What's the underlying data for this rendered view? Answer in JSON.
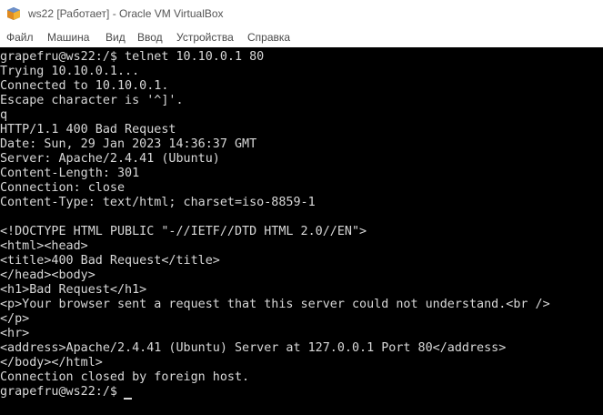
{
  "window": {
    "title": "ws22 [Работает] - Oracle VM VirtualBox"
  },
  "menu": {
    "items": [
      {
        "label": "Файл"
      },
      {
        "label": "Машина"
      },
      {
        "label": "Вид"
      },
      {
        "label": "Ввод"
      },
      {
        "label": "Устройства"
      },
      {
        "label": "Справка"
      }
    ]
  },
  "terminal": {
    "lines": [
      "grapefru@ws22:/$ telnet 10.10.0.1 80",
      "Trying 10.10.0.1...",
      "Connected to 10.10.0.1.",
      "Escape character is '^]'.",
      "q",
      "HTTP/1.1 400 Bad Request",
      "Date: Sun, 29 Jan 2023 14:36:37 GMT",
      "Server: Apache/2.4.41 (Ubuntu)",
      "Content-Length: 301",
      "Connection: close",
      "Content-Type: text/html; charset=iso-8859-1",
      "",
      "<!DOCTYPE HTML PUBLIC \"-//IETF//DTD HTML 2.0//EN\">",
      "<html><head>",
      "<title>400 Bad Request</title>",
      "</head><body>",
      "<h1>Bad Request</h1>",
      "<p>Your browser sent a request that this server could not understand.<br />",
      "</p>",
      "<hr>",
      "<address>Apache/2.4.41 (Ubuntu) Server at 127.0.0.1 Port 80</address>",
      "</body></html>",
      "Connection closed by foreign host.",
      "grapefru@ws22:/$ "
    ]
  }
}
